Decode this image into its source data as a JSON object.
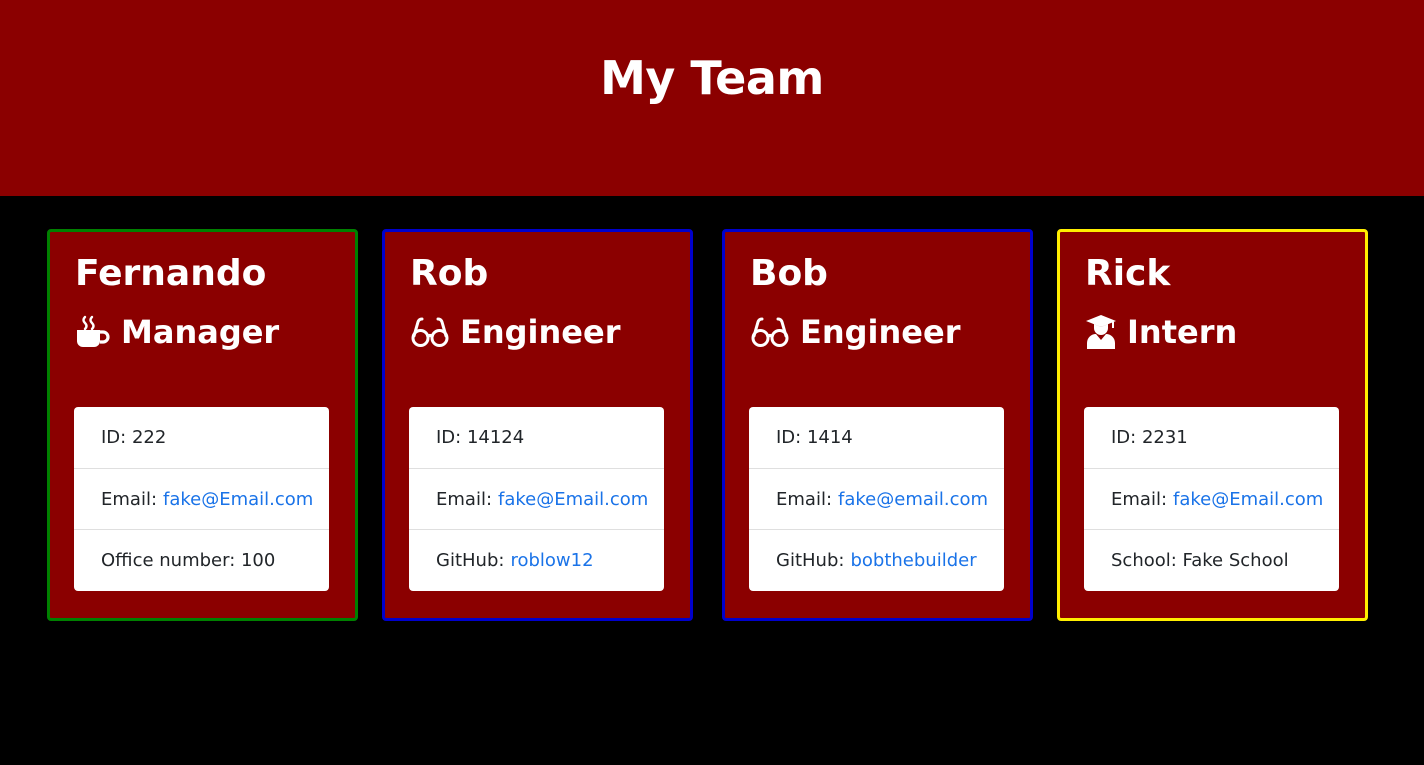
{
  "header": {
    "title": "My Team",
    "background": "#8b0000"
  },
  "colors": {
    "page_background": "#000000",
    "card_background": "#8b0000",
    "link": "#1a73e8",
    "manager_border": "#008000",
    "engineer_border": "#0000cc",
    "intern_border": "#ffee00"
  },
  "cards": [
    {
      "name": "Fernando",
      "role": "Manager",
      "role_icon": "coffee-mug-icon",
      "border_color": "#008000",
      "id_text": "ID: 222",
      "email_label": "Email:",
      "email": "fake@Email.com",
      "extra_label": "Office number: 100",
      "extra_link": ""
    },
    {
      "name": "Rob",
      "role": "Engineer",
      "role_icon": "glasses-icon",
      "border_color": "#0000cc",
      "id_text": "ID: 14124",
      "email_label": "Email:",
      "email": "fake@Email.com",
      "extra_label": "GitHub:",
      "extra_link": "roblow12"
    },
    {
      "name": "Bob",
      "role": "Engineer",
      "role_icon": "glasses-icon",
      "border_color": "#0000cc",
      "id_text": "ID: 1414",
      "email_label": "Email:",
      "email": "fake@email.com",
      "extra_label": "GitHub:",
      "extra_link": "bobthebuilder"
    },
    {
      "name": "Rick",
      "role": "Intern",
      "role_icon": "graduate-icon",
      "border_color": "#ffee00",
      "id_text": "ID: 2231",
      "email_label": "Email:",
      "email": "fake@Email.com",
      "extra_label": "School: Fake School",
      "extra_link": ""
    }
  ]
}
